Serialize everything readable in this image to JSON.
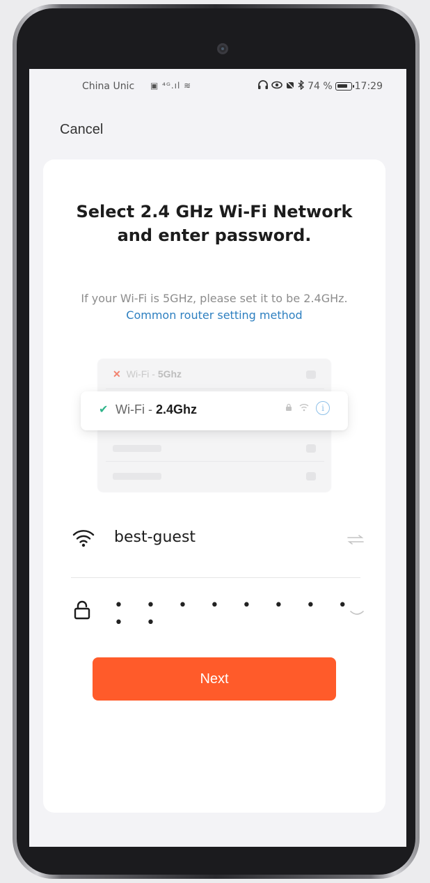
{
  "status_bar": {
    "carrier": "China Unic",
    "network_indicators": "▣ ⁴ᴳ.ıl ≋",
    "battery_percent": "74 %",
    "time": "17:29"
  },
  "header": {
    "cancel_label": "Cancel"
  },
  "card": {
    "title": "Select 2.4 GHz Wi-Fi Network and enter password.",
    "hint_text": "If your Wi-Fi is 5GHz, please set it to be 2.4GHz. ",
    "hint_link": "Common router setting method",
    "illustration": {
      "row_5g_prefix": "Wi-Fi - ",
      "row_5g_band": "5Ghz",
      "row_24g_prefix": "Wi-Fi - ",
      "row_24g_band": "2.4Ghz"
    },
    "wifi_field": {
      "value": "best-guest"
    },
    "password_field": {
      "masked_value": "• • • • • • • • • •"
    },
    "next_label": "Next"
  },
  "colors": {
    "accent": "#ff5b2a",
    "link": "#2d7fc0",
    "check": "#2fb48a",
    "error": "#f2836f"
  },
  "icons": [
    "wifi-icon",
    "lock-icon",
    "switch-network-icon",
    "eye-closed-icon",
    "check-icon",
    "cross-icon",
    "info-icon"
  ]
}
